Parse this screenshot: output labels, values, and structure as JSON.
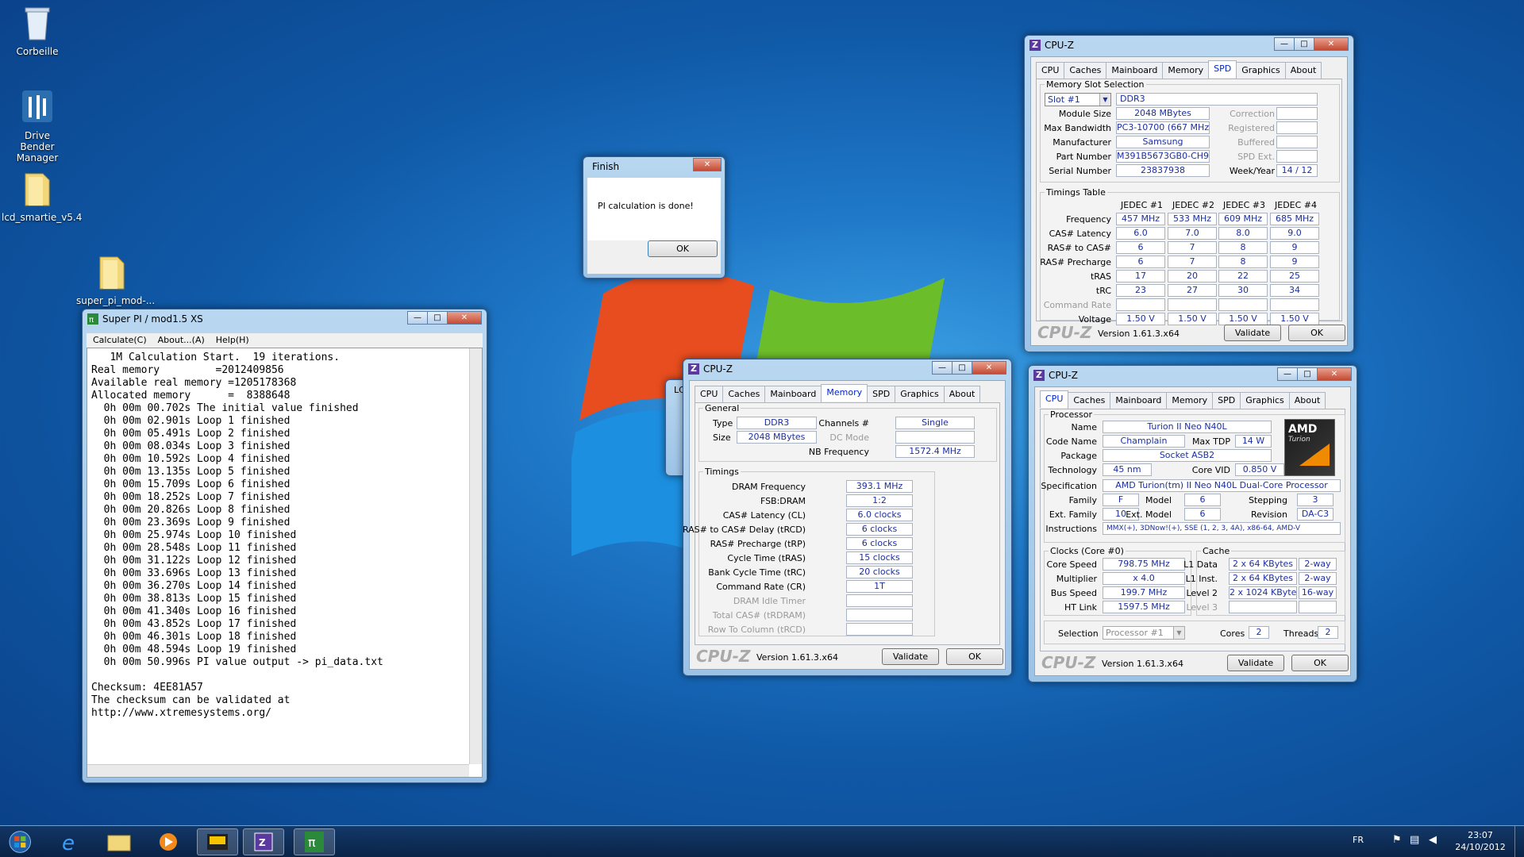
{
  "desktop": {
    "icons": [
      {
        "label": "Corbeille"
      },
      {
        "label": "Drive Bender Manager"
      },
      {
        "label": "lcd_smartie_v5.4"
      },
      {
        "label": "super_pi_mod-..."
      }
    ]
  },
  "superpi": {
    "title": "Super PI / mod1.5 XS",
    "menu": [
      "Calculate(C)",
      "About...(A)",
      "Help(H)"
    ],
    "lines": [
      "   1M Calculation Start.  19 iterations.",
      "Real memory         =2012409856",
      "Available real memory =1205178368",
      "Allocated memory      =  8388648",
      "  0h 00m 00.702s The initial value finished",
      "  0h 00m 02.901s Loop 1 finished",
      "  0h 00m 05.491s Loop 2 finished",
      "  0h 00m 08.034s Loop 3 finished",
      "  0h 00m 10.592s Loop 4 finished",
      "  0h 00m 13.135s Loop 5 finished",
      "  0h 00m 15.709s Loop 6 finished",
      "  0h 00m 18.252s Loop 7 finished",
      "  0h 00m 20.826s Loop 8 finished",
      "  0h 00m 23.369s Loop 9 finished",
      "  0h 00m 25.974s Loop 10 finished",
      "  0h 00m 28.548s Loop 11 finished",
      "  0h 00m 31.122s Loop 12 finished",
      "  0h 00m 33.696s Loop 13 finished",
      "  0h 00m 36.270s Loop 14 finished",
      "  0h 00m 38.813s Loop 15 finished",
      "  0h 00m 41.340s Loop 16 finished",
      "  0h 00m 43.852s Loop 17 finished",
      "  0h 00m 46.301s Loop 18 finished",
      "  0h 00m 48.594s Loop 19 finished",
      "  0h 00m 50.996s PI value output -> pi_data.txt",
      "",
      "Checksum: 4EE81A57",
      "The checksum can be validated at",
      "http://www.xtremesystems.org/"
    ]
  },
  "finish": {
    "title": "Finish",
    "message": "PI calculation is done!",
    "ok": "OK"
  },
  "cpuz_common": {
    "title": "CPU-Z",
    "tabs": [
      "CPU",
      "Caches",
      "Mainboard",
      "Memory",
      "SPD",
      "Graphics",
      "About"
    ],
    "brand": "CPU-Z",
    "version": "Version 1.61.3.x64",
    "validate": "Validate",
    "ok": "OK"
  },
  "memory": {
    "general_legend": "General",
    "type_label": "Type",
    "type": "DDR3",
    "size_label": "Size",
    "size": "2048 MBytes",
    "channels_label": "Channels #",
    "channels": "Single",
    "dcmode_label": "DC Mode",
    "nbfreq_label": "NB Frequency",
    "nbfreq": "1572.4 MHz",
    "timings_legend": "Timings",
    "timings": [
      {
        "label": "DRAM Frequency",
        "value": "393.1 MHz"
      },
      {
        "label": "FSB:DRAM",
        "value": "1:2"
      },
      {
        "label": "CAS# Latency (CL)",
        "value": "6.0 clocks"
      },
      {
        "label": "RAS# to CAS# Delay (tRCD)",
        "value": "6 clocks"
      },
      {
        "label": "RAS# Precharge (tRP)",
        "value": "6 clocks"
      },
      {
        "label": "Cycle Time (tRAS)",
        "value": "15 clocks"
      },
      {
        "label": "Bank Cycle Time (tRC)",
        "value": "20 clocks"
      },
      {
        "label": "Command Rate (CR)",
        "value": "1T"
      },
      {
        "label": "DRAM Idle Timer",
        "value": ""
      },
      {
        "label": "Total CAS# (tRDRAM)",
        "value": ""
      },
      {
        "label": "Row To Column (tRCD)",
        "value": ""
      }
    ]
  },
  "spd": {
    "slot_legend": "Memory Slot Selection",
    "slot": "Slot #1",
    "type": "DDR3",
    "rows": [
      {
        "label": "Module Size",
        "value": "2048 MBytes",
        "rlabel": "Correction",
        "rvalue": ""
      },
      {
        "label": "Max Bandwidth",
        "value": "PC3-10700 (667 MHz)",
        "rlabel": "Registered",
        "rvalue": ""
      },
      {
        "label": "Manufacturer",
        "value": "Samsung",
        "rlabel": "Buffered",
        "rvalue": ""
      },
      {
        "label": "Part Number",
        "value": "M391B5673GB0-CH9",
        "rlabel": "SPD Ext.",
        "rvalue": ""
      },
      {
        "label": "Serial Number",
        "value": "23837938",
        "rlabel": "Week/Year",
        "rvalue": "14 / 12"
      }
    ],
    "timings_legend": "Timings Table",
    "cols": [
      "JEDEC #1",
      "JEDEC #2",
      "JEDEC #3",
      "JEDEC #4"
    ],
    "trows": [
      {
        "label": "Frequency",
        "vals": [
          "457 MHz",
          "533 MHz",
          "609 MHz",
          "685 MHz"
        ]
      },
      {
        "label": "CAS# Latency",
        "vals": [
          "6.0",
          "7.0",
          "8.0",
          "9.0"
        ]
      },
      {
        "label": "RAS# to CAS#",
        "vals": [
          "6",
          "7",
          "8",
          "9"
        ]
      },
      {
        "label": "RAS# Precharge",
        "vals": [
          "6",
          "7",
          "8",
          "9"
        ]
      },
      {
        "label": "tRAS",
        "vals": [
          "17",
          "20",
          "22",
          "25"
        ]
      },
      {
        "label": "tRC",
        "vals": [
          "23",
          "27",
          "30",
          "34"
        ]
      },
      {
        "label": "Command Rate",
        "vals": [
          "",
          "",
          "",
          ""
        ]
      },
      {
        "label": "Voltage",
        "vals": [
          "1.50 V",
          "1.50 V",
          "1.50 V",
          "1.50 V"
        ]
      }
    ]
  },
  "cpu": {
    "processor_legend": "Processor",
    "name_label": "Name",
    "name": "Turion II Neo N40L",
    "codename_label": "Code Name",
    "codename": "Champlain",
    "maxtdp_label": "Max TDP",
    "maxtdp": "14 W",
    "package_label": "Package",
    "package": "Socket ASB2",
    "tech_label": "Technology",
    "tech": "45 nm",
    "corevid_label": "Core VID",
    "corevid": "0.850 V",
    "spec_label": "Specification",
    "spec": "AMD Turion(tm) II Neo N40L Dual-Core Processor",
    "family_label": "Family",
    "family": "F",
    "model_label": "Model",
    "model": "6",
    "stepping_label": "Stepping",
    "stepping": "3",
    "extfamily_label": "Ext. Family",
    "extfamily": "10",
    "extmodel_label": "Ext. Model",
    "extmodel": "6",
    "revision_label": "Revision",
    "revision": "DA-C3",
    "instr_label": "Instructions",
    "instr": "MMX(+), 3DNow!(+), SSE (1, 2, 3, 4A), x86-64, AMD-V",
    "clocks_legend": "Clocks (Core #0)",
    "corespeed_label": "Core Speed",
    "corespeed": "798.75 MHz",
    "mult_label": "Multiplier",
    "mult": "x 4.0",
    "bus_label": "Bus Speed",
    "bus": "199.7 MHz",
    "ht_label": "HT Link",
    "ht": "1597.5 MHz",
    "cache_legend": "Cache",
    "l1d_label": "L1 Data",
    "l1d": "2 x 64 KBytes",
    "l1d_way": "2-way",
    "l1i_label": "L1 Inst.",
    "l1i": "2 x 64 KBytes",
    "l1i_way": "2-way",
    "l2_label": "Level 2",
    "l2": "2 x 1024 KBytes",
    "l2_way": "16-way",
    "l3_label": "Level 3",
    "selection_label": "Selection",
    "selection": "Processor #1",
    "cores_label": "Cores",
    "cores": "2",
    "threads_label": "Threads",
    "threads": "2",
    "amd_logo": "AMD",
    "turion": "Turion"
  },
  "taskbar": {
    "lang": "FR",
    "time": "23:07",
    "date": "24/10/2012"
  },
  "colors": {
    "accent": "#0026c9",
    "value_text": "#1c2fa0"
  }
}
